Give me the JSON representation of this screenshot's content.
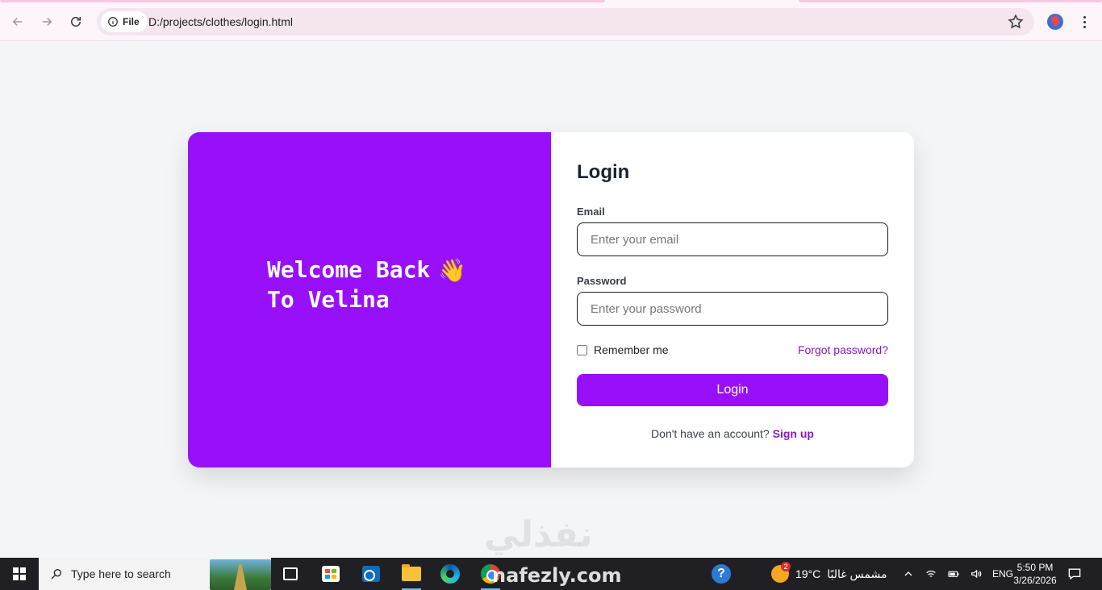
{
  "browser": {
    "url_chip_label": "File",
    "url": "D:/projects/clothes/login.html",
    "icons": [
      "back-icon",
      "forward-icon",
      "reload-icon",
      "info-icon",
      "star-icon",
      "profile-avatar",
      "kebab-menu-icon"
    ]
  },
  "page": {
    "hero": {
      "line1": "Welcome Back",
      "line2": "To Velina",
      "emoji": "👋"
    },
    "form": {
      "title": "Login",
      "email_label": "Email",
      "email_placeholder": "Enter your email",
      "password_label": "Password",
      "password_placeholder": "Enter your password",
      "remember_label": "Remember me",
      "forgot_link": "Forgot password?",
      "submit_label": "Login",
      "signup_prompt": "Don't have an account?",
      "signup_link": "Sign up"
    },
    "colors": {
      "accent": "#9810fa",
      "link": "#8a18c8",
      "background": "#f3f5f7"
    }
  },
  "watermark": {
    "arabic": "نفذلي",
    "latin": "nafezly.com"
  },
  "taskbar": {
    "search_placeholder": "Type here to search",
    "weather_badge": "2",
    "weather_temp": "19°C",
    "weather_text": "مشمس غالبًا",
    "language": "ENG",
    "time": "5:50 PM",
    "date": "3/26/2026",
    "help_glyph": "?"
  }
}
